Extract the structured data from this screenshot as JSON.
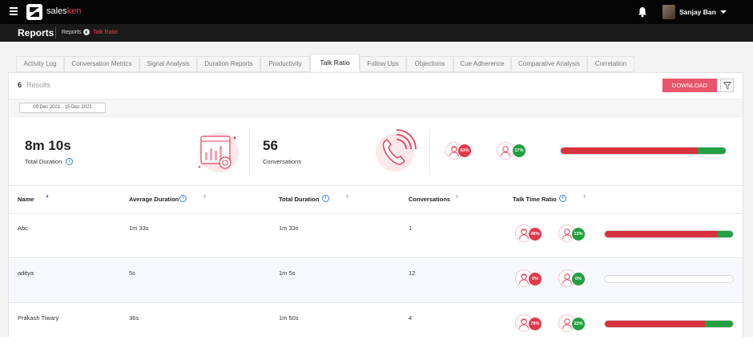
{
  "app": {
    "brand_prefix": "sales",
    "brand_suffix": "ken",
    "user_name": "Sanjay Ban"
  },
  "subheader": {
    "title": "Reports",
    "breadcrumb": "Reports",
    "breadcrumb_active": "Talk Ratio"
  },
  "tabs": [
    {
      "label": "Activity Log"
    },
    {
      "label": "Conversation Metrics"
    },
    {
      "label": "Signal Analysis"
    },
    {
      "label": "Duration Reports"
    },
    {
      "label": "Productivity"
    },
    {
      "label": "Talk Ratio",
      "active": true
    },
    {
      "label": "Follow Ups"
    },
    {
      "label": "Objections"
    },
    {
      "label": "Cue Adherence"
    },
    {
      "label": "Comparative Analysis"
    },
    {
      "label": "Correlation"
    }
  ],
  "results": {
    "count": "6",
    "label": "Results",
    "download_label": "DOWNLOAD"
  },
  "date_range": "09 Dec 2021 - 15 Dec 2021",
  "summary": {
    "total_duration": "8m 10s",
    "total_duration_label": "Total Duration",
    "conversations": "56",
    "conversations_label": "Conversations",
    "agent_pct": "83%",
    "customer_pct": "17%",
    "agent_ratio": 0.83
  },
  "table": {
    "columns": {
      "name": "Name",
      "avg_duration": "Average Duration",
      "total_duration": "Total Duration",
      "conversations": "Conversations",
      "talk_ratio": "Talk Time Ratio"
    },
    "rows": [
      {
        "name": "Abc",
        "avg_duration": "1m 33s",
        "total_duration": "1m 33s",
        "conversations": "1",
        "agent_pct": "88%",
        "customer_pct": "12%",
        "agent_ratio": 0.88,
        "customer_ratio": 0.12
      },
      {
        "name": "aditya",
        "avg_duration": "5s",
        "total_duration": "1m 5s",
        "conversations": "12",
        "agent_pct": "0%",
        "customer_pct": "0%",
        "agent_ratio": 0,
        "customer_ratio": 0
      },
      {
        "name": "Prakash Tiwary",
        "avg_duration": "36s",
        "total_duration": "1m 50s",
        "conversations": "4",
        "agent_pct": "78%",
        "customer_pct": "22%",
        "agent_ratio": 0.78,
        "customer_ratio": 0.22
      }
    ]
  },
  "colors": {
    "accent": "#e8415a",
    "agent": "#d8323f",
    "customer": "#23a043"
  }
}
